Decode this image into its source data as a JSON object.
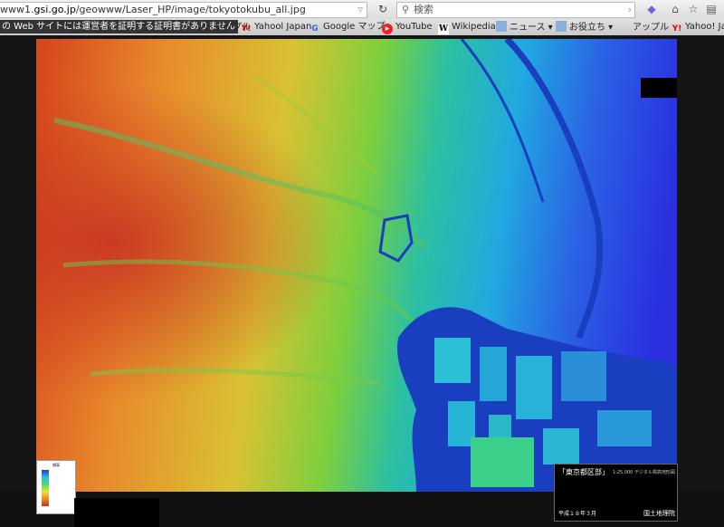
{
  "browser": {
    "url_prefix": "www1.",
    "url_host": "gsi.go.jp",
    "url_path": "/geowww/Laser_HP/image/tokyotokubu_all.jpg",
    "search_placeholder": "検索"
  },
  "bookmarks": {
    "cert_warning": "の Web サイトには運営者を証明する証明書がありません",
    "items": [
      {
        "label": "アップル",
        "icon": "apple-icon"
      },
      {
        "label": "Yahool Japan",
        "icon": "yahoo-icon"
      },
      {
        "label": "Google マップ",
        "icon": "google-icon"
      },
      {
        "label": "YouTube",
        "icon": "youtube-icon"
      },
      {
        "label": "Wikipedia",
        "icon": "wikipedia-icon"
      },
      {
        "label": "ニュース",
        "icon": "folder-icon"
      },
      {
        "label": "お役立ち",
        "icon": "folder-icon"
      },
      {
        "label": "アップル",
        "icon": "apple-icon"
      },
      {
        "label": "Yahoo! Japan",
        "icon": "yahoo-icon"
      }
    ]
  },
  "map": {
    "title": "「東京都区部」",
    "scale": "1:25,000 デジタル標高地形図",
    "date": "平成１８年３月",
    "org": "国土地理院",
    "legend_title": "標高"
  },
  "colors": {
    "toolbar": "#dcdcdc",
    "water": "#1a3ec0",
    "high": "#c83220",
    "low": "#2a2fe0"
  }
}
